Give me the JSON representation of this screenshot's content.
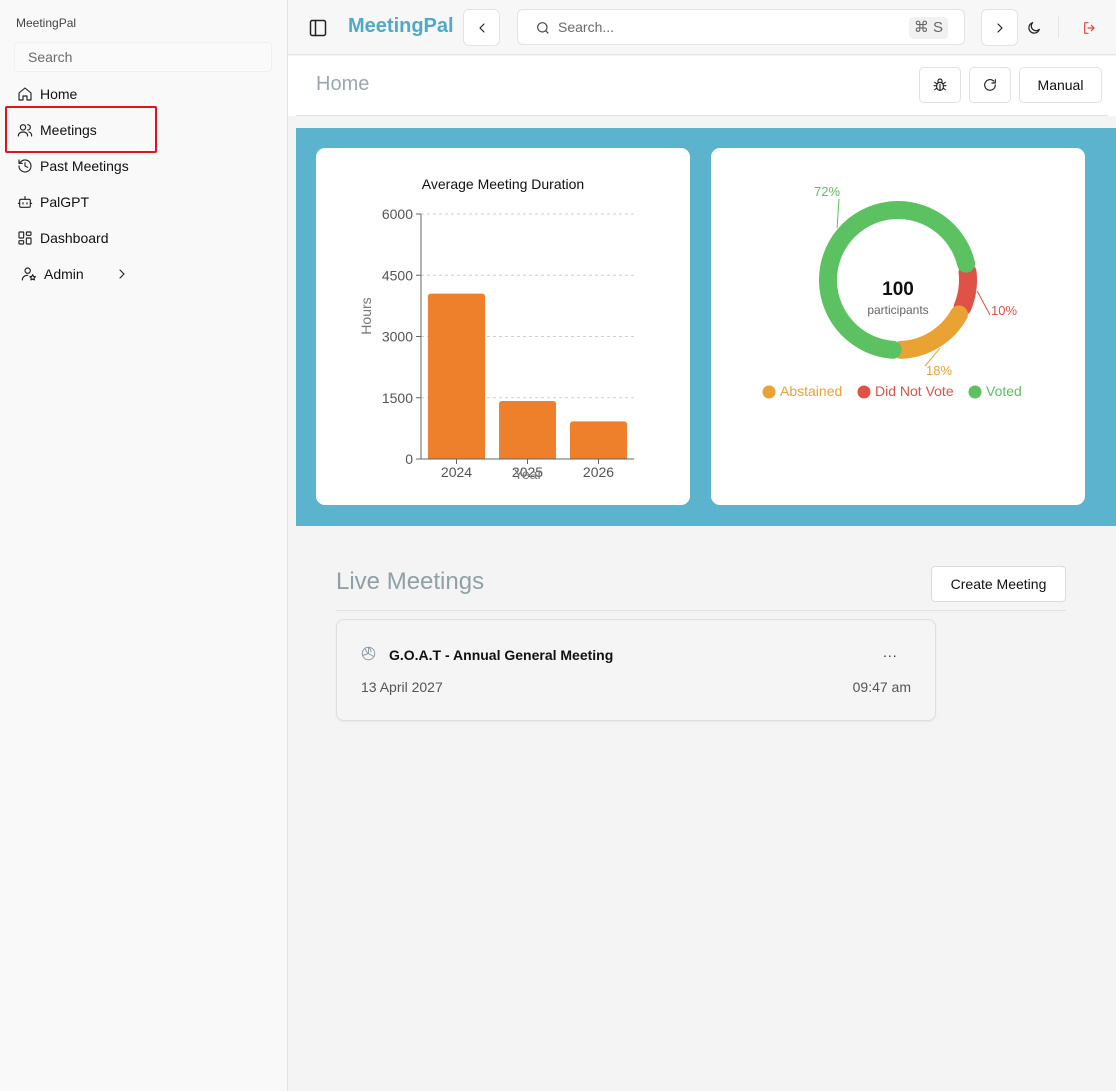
{
  "sidebar": {
    "title": "MeetingPal",
    "search_placeholder": "Search",
    "items": [
      {
        "label": "Home",
        "icon": "home-icon"
      },
      {
        "label": "Meetings",
        "icon": "users-icon"
      },
      {
        "label": "Past Meetings",
        "icon": "history-icon"
      },
      {
        "label": "PalGPT",
        "icon": "bot-icon"
      },
      {
        "label": "Dashboard",
        "icon": "dashboard-icon"
      },
      {
        "label": "Admin",
        "icon": "user-cog-icon"
      }
    ]
  },
  "topbar": {
    "brand": "MeetingPal",
    "search_placeholder": "Search...",
    "shortcut": "⌘ S",
    "brand_color": "#4fa9c9"
  },
  "page": {
    "title": "Home",
    "manual_label": "Manual"
  },
  "dashboard": {
    "background": "#5bb3ce"
  },
  "chart_data": [
    {
      "type": "bar",
      "title": "Average Meeting Duration",
      "xlabel": "Year",
      "ylabel": "Hours",
      "categories": [
        "2024",
        "2025",
        "2026"
      ],
      "values": [
        4050,
        1420,
        920
      ],
      "ylim": [
        0,
        6000
      ],
      "yticks": [
        "0",
        "1500",
        "3000",
        "4500",
        "6000"
      ],
      "grid": true,
      "color": "#ee7f2b"
    },
    {
      "type": "pie",
      "center_value": "100",
      "center_label": "participants",
      "slices": [
        {
          "name": "Voted",
          "value": 72,
          "label": "72%",
          "color": "#5cc160"
        },
        {
          "name": "Did Not Vote",
          "value": 10,
          "label": "10%",
          "color": "#df5246"
        },
        {
          "name": "Abstained",
          "value": 18,
          "label": "18%",
          "color": "#eaa235"
        }
      ],
      "legend": [
        "Abstained",
        "Did Not Vote",
        "Voted"
      ],
      "legend_position": "bottom"
    }
  ],
  "live": {
    "title": "Live Meetings",
    "create_label": "Create Meeting",
    "meetings": [
      {
        "title": "G.O.A.T - Annual General Meeting",
        "date": "13 April 2027",
        "time": "09:47 am",
        "menu": "..."
      }
    ]
  }
}
